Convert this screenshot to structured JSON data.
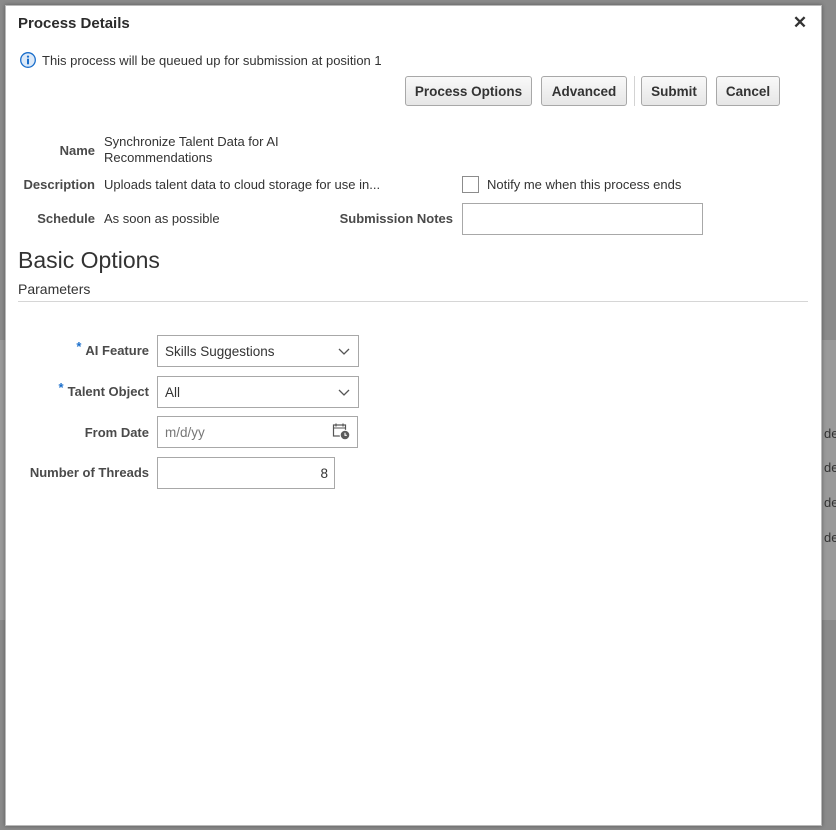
{
  "background": {
    "row_fragments": [
      "de",
      "de",
      "de",
      "de"
    ]
  },
  "dialog": {
    "title": "Process Details",
    "close_glyph": "✕",
    "info_message": "This process will be queued up for submission at position 1",
    "buttons": {
      "process_options": "Process Options",
      "advanced": "Advanced",
      "submit": "Submit",
      "cancel": "Cancel"
    },
    "details": {
      "name_label": "Name",
      "name_value": "Synchronize Talent Data for AI Recommendations",
      "description_label": "Description",
      "description_value": "Uploads talent data to cloud storage for use in...",
      "schedule_label": "Schedule",
      "schedule_value": "As soon as possible",
      "notify_label": "Notify me when this process ends",
      "notify_checked": false,
      "submission_notes_label": "Submission Notes",
      "submission_notes_value": ""
    },
    "basic_options": {
      "title": "Basic Options",
      "subtitle": "Parameters",
      "params": {
        "ai_feature_label": "AI Feature",
        "ai_feature_value": "Skills Suggestions",
        "talent_object_label": "Talent Object",
        "talent_object_value": "All",
        "from_date_label": "From Date",
        "from_date_placeholder": "m/d/yy",
        "threads_label": "Number of Threads",
        "threads_value": "8"
      }
    }
  },
  "icons": {
    "info": "info-icon",
    "close": "close-icon",
    "dropdown": "chevron-down-icon",
    "calendar": "calendar-icon"
  },
  "colors": {
    "accent": "#1a6ecb",
    "dialog_bg": "#ffffff",
    "overlay": "#8a8a8a"
  }
}
